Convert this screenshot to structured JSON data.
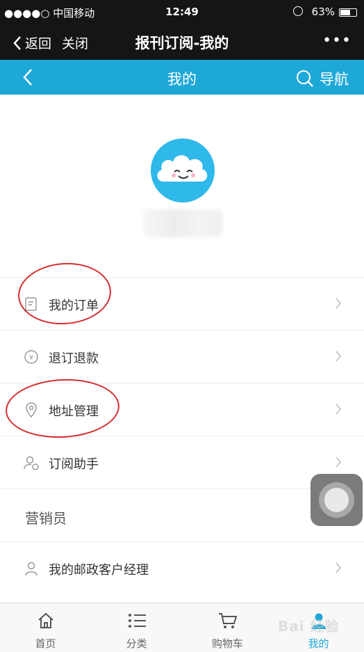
{
  "status_bar": {
    "carrier": "●●●●○ 中国移动",
    "time": "12:49",
    "battery_pct": "63%",
    "battery_level": 0.63
  },
  "wechat_nav": {
    "back_label": "返回",
    "close_label": "关闭",
    "title": "报刊订阅-我的",
    "more_label": "•••"
  },
  "app_header": {
    "title": "我的",
    "nav_label": "导航"
  },
  "menu": {
    "items": [
      {
        "label": "我的订单",
        "icon": "order-icon"
      },
      {
        "label": "退订退款",
        "icon": "refund-icon"
      },
      {
        "label": "地址管理",
        "icon": "location-icon"
      },
      {
        "label": "订阅助手",
        "icon": "assistant-icon"
      }
    ],
    "section_label": "营销员",
    "manager_item": {
      "label": "我的邮政客户经理",
      "icon": "manager-icon"
    }
  },
  "tabbar": {
    "tabs": [
      {
        "label": "首页",
        "icon": "home-icon"
      },
      {
        "label": "分类",
        "icon": "list-icon"
      },
      {
        "label": "购物车",
        "icon": "cart-icon"
      },
      {
        "label": "我的",
        "icon": "profile-icon",
        "active": true
      }
    ]
  },
  "watermark": "Bai 经验",
  "colors": {
    "accent": "#1ea8d8",
    "dark_bar": "#151515",
    "annotation": "#d62f2f"
  }
}
